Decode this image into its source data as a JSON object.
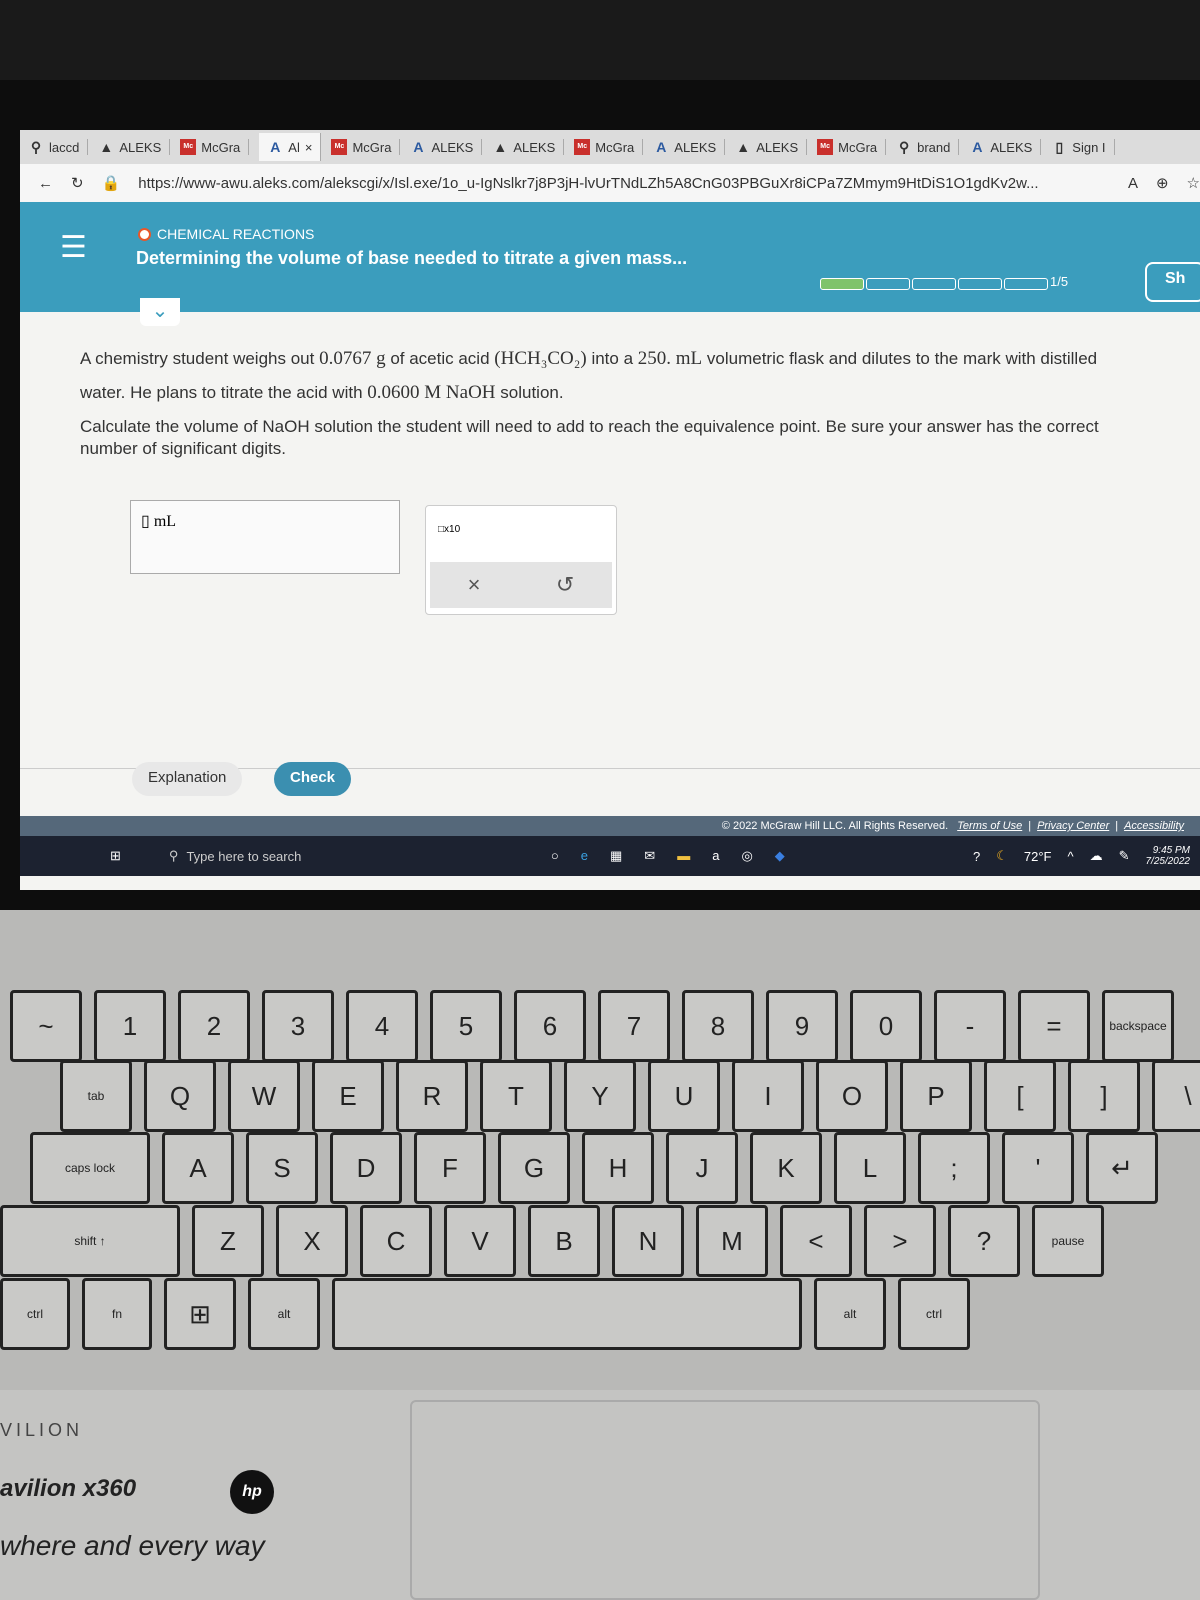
{
  "browser": {
    "tabs": [
      {
        "icon": "search",
        "label": "laccd"
      },
      {
        "icon": "aleks-mortar",
        "label": "ALEKS"
      },
      {
        "icon": "mcgraw",
        "label": "McGra"
      },
      {
        "icon": "aleks-a",
        "label": "Al",
        "active": true,
        "close": "×"
      },
      {
        "icon": "mcgraw",
        "label": "McGra"
      },
      {
        "icon": "aleks-a",
        "label": "ALEKS"
      },
      {
        "icon": "aleks-mortar",
        "label": "ALEKS"
      },
      {
        "icon": "mcgraw",
        "label": "McGra"
      },
      {
        "icon": "aleks-a",
        "label": "ALEKS"
      },
      {
        "icon": "aleks-mortar",
        "label": "ALEKS"
      },
      {
        "icon": "mcgraw",
        "label": "McGra"
      },
      {
        "icon": "search",
        "label": "brand"
      },
      {
        "icon": "aleks-a",
        "label": "ALEKS"
      },
      {
        "icon": "page",
        "label": "Sign I"
      }
    ],
    "url": "https://www-awu.aleks.com/alekscgi/x/Isl.exe/1o_u-IgNslkr7j8P3jH-lvUrTNdLZh5A8CnG03PBGuXr8iCPa7ZMmym9HtDiS1O1gdKv2w..."
  },
  "header": {
    "topic": "CHEMICAL REACTIONS",
    "title": "Determining the volume of base needed to titrate a given mass...",
    "progress_label": "1/5",
    "progress_fraction": 0.2,
    "sh_label": "Sh",
    "accent": "#3b9dbd"
  },
  "question": {
    "p1a": "A chemistry student weighs out",
    "mass": "0.0767 g",
    "p1b": "of acetic acid",
    "formula": "(HCH₃CO₂)",
    "p1c": "into a",
    "vol": "250. mL",
    "p1d": "volumetric flask and dilutes to the mark with distilled water. He plans to titrate the acid with",
    "conc": "0.0600 M NaOH",
    "p1e": "solution.",
    "p2": "Calculate the volume of NaOH solution the student will need to add to reach the equivalence point. Be sure your answer has the correct number of significant digits.",
    "unit": "mL",
    "answer_value": ""
  },
  "tools": {
    "x10": "x10",
    "clear": "×",
    "undo": "↺"
  },
  "buttons": {
    "explanation": "Explanation",
    "check": "Check"
  },
  "footer": {
    "copyright": "© 2022 McGraw Hill LLC. All Rights Reserved.",
    "terms": "Terms of Use",
    "privacy": "Privacy Center",
    "accessibility": "Accessibility"
  },
  "taskbar": {
    "search_placeholder": "Type here to search",
    "weather": "72°F",
    "time": "9:45 PM",
    "date": "7/25/2022"
  },
  "keyboard": {
    "row1": [
      "~",
      "1",
      "2",
      "3",
      "4",
      "5",
      "6",
      "7",
      "8",
      "9",
      "0",
      "-",
      "=",
      "backspace"
    ],
    "row2": [
      "tab",
      "Q",
      "W",
      "E",
      "R",
      "T",
      "Y",
      "U",
      "I",
      "O",
      "P",
      "[",
      "]",
      "\\"
    ],
    "row3": [
      "caps lock",
      "A",
      "S",
      "D",
      "F",
      "G",
      "H",
      "J",
      "K",
      "L",
      ";",
      "'",
      "↵"
    ],
    "row4": [
      "shift ↑",
      "Z",
      "X",
      "C",
      "V",
      "B",
      "N",
      "M",
      "<",
      ">",
      "?",
      "pause"
    ],
    "row5": [
      "ctrl",
      "fn",
      "⊞",
      "alt",
      "",
      "alt",
      "ctrl"
    ]
  },
  "laptop": {
    "brand1": "VILION",
    "brand2": "avilion x360",
    "brand3": "where and every way",
    "hp": "hp"
  }
}
